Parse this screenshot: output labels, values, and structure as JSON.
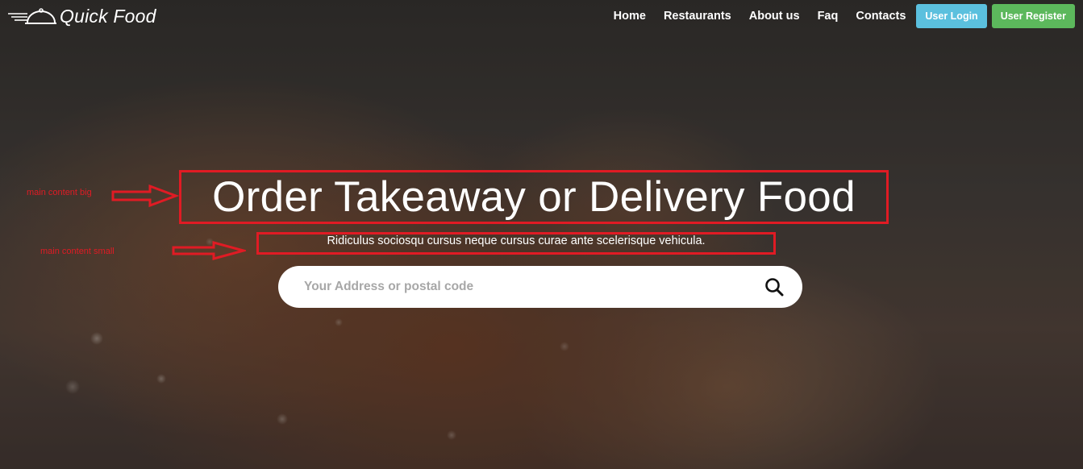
{
  "brand": {
    "name": "Quick Food",
    "logo_icon": "cloche-icon"
  },
  "nav": {
    "links": [
      "Home",
      "Restaurants",
      "About us",
      "Faq",
      "Contacts"
    ],
    "login_label": "User Login",
    "register_label": "User Register"
  },
  "hero": {
    "title": "Order Takeaway or Delivery Food",
    "subtitle": "Ridiculus sociosqu cursus neque cursus curae ante scelerisque vehicula."
  },
  "search": {
    "placeholder": "Your Address or postal code",
    "value": "",
    "icon": "search-icon"
  },
  "annotations": {
    "big": "main content big",
    "small": "main content small"
  },
  "colors": {
    "login": "#5bc0de",
    "register": "#5cb85c",
    "annotation": "#e01b24"
  }
}
